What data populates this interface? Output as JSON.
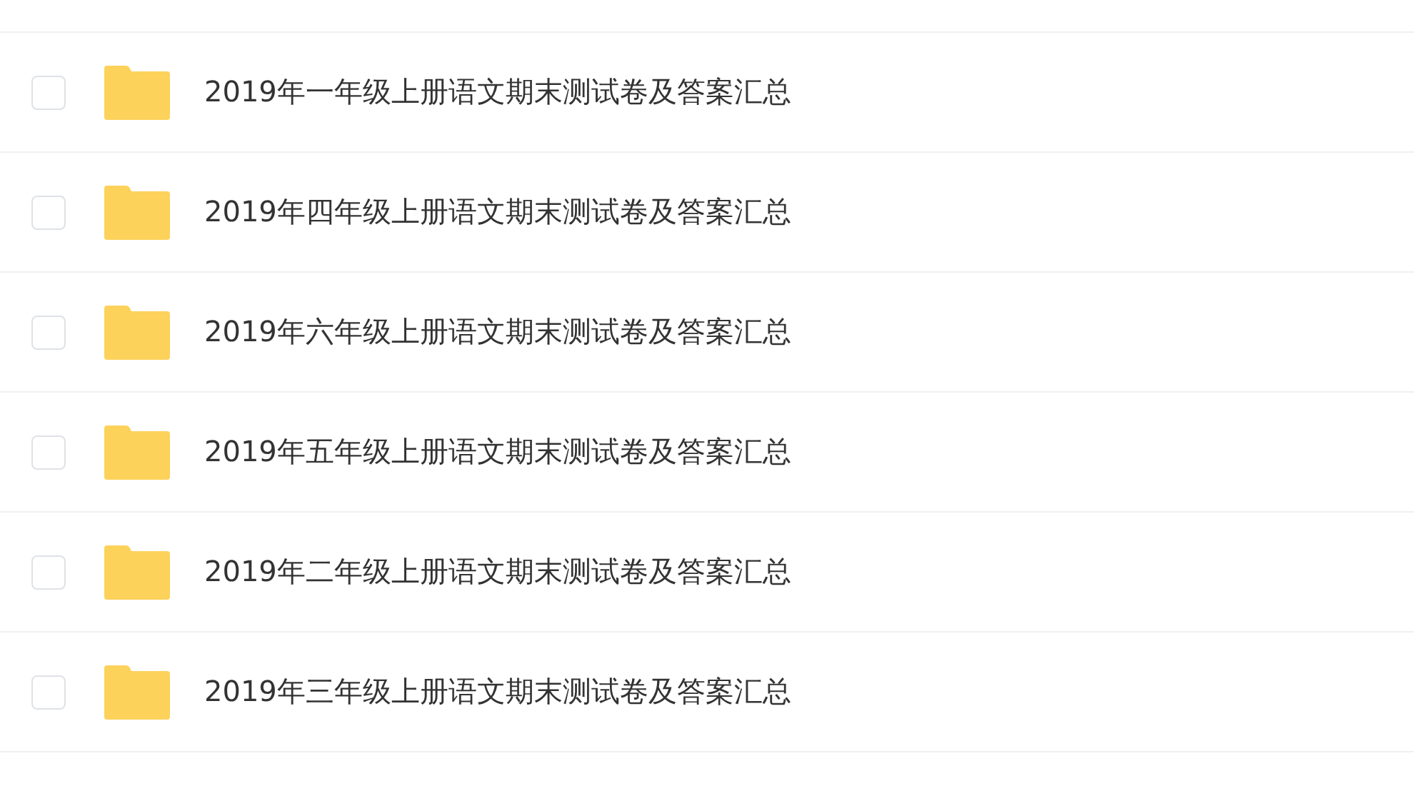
{
  "files": [
    {
      "name": "2019年一年级上册语文期末测试卷及答案汇总",
      "checked": false
    },
    {
      "name": "2019年四年级上册语文期末测试卷及答案汇总",
      "checked": false
    },
    {
      "name": "2019年六年级上册语文期末测试卷及答案汇总",
      "checked": false
    },
    {
      "name": "2019年五年级上册语文期末测试卷及答案汇总",
      "checked": false
    },
    {
      "name": "2019年二年级上册语文期末测试卷及答案汇总",
      "checked": false
    },
    {
      "name": "2019年三年级上册语文期末测试卷及答案汇总",
      "checked": false
    }
  ]
}
